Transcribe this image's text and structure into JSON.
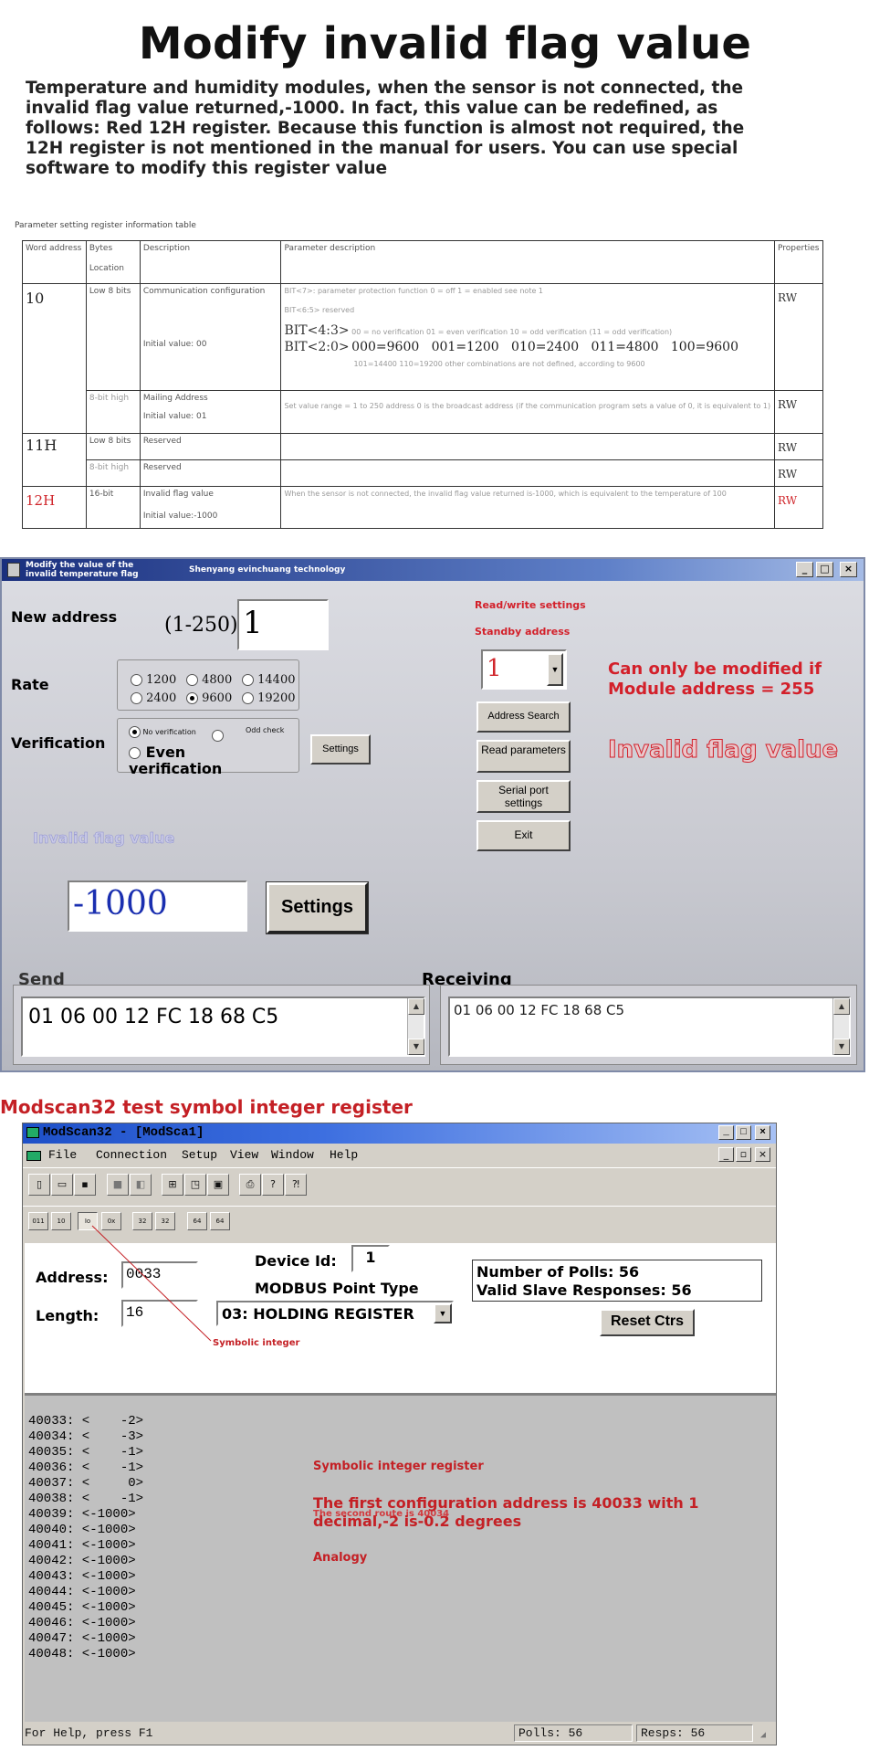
{
  "heading": "Modify invalid flag value",
  "intro": "Temperature and humidity modules, when the sensor is not connected, the invalid flag value returned,-1000. In fact, this value can be redefined, as follows: Red 12H register. Because this function is almost not required, the 12H register is not mentioned in the manual for users. You can use special software to modify this register value",
  "table": {
    "caption": "Parameter setting register information table",
    "headers": {
      "word": "Word address",
      "bytes": "Bytes",
      "location": "Location",
      "description": "Description",
      "param": "Parameter description",
      "props": "Properties"
    },
    "row10": {
      "addr": "10",
      "low": "Low 8 bits",
      "desc": "Communication configuration",
      "init": "Initial value: 00",
      "bit7": "BIT<7>: parameter protection function 0 = off 1 = enabled see note 1",
      "bit65": "BIT<6:5> reserved",
      "bit43": "BIT<4:3>",
      "bit43_desc": "00 = no verification 01 = even verification 10 = odd verification (11 = odd verification)",
      "bit20": "BIT<2:0>",
      "baud": "000=9600   001=1200   010=2400   011=4800   100=9600",
      "baud_note": "101=14400 110=19200 other combinations are not defined, according to 9600",
      "prop": "RW"
    },
    "row10b": {
      "high": "8-bit high",
      "desc": "Mailing Address",
      "init": "Initial value: 01",
      "param": "Set value range = 1 to 250 address 0 is the broadcast address (if the communication program sets a value of 0, it is equivalent to 1)",
      "prop": "RW"
    },
    "row11": {
      "addr": "11H",
      "low": "Low 8 bits",
      "desc": "Reserved",
      "prop": "RW"
    },
    "row11b": {
      "high": "8-bit high",
      "desc": "Reserved",
      "prop": "RW"
    },
    "row12": {
      "addr": "12H",
      "bytes": "16-bit",
      "desc": "Invalid flag value",
      "init": "Initial value:-1000",
      "param": "When the sensor is not connected, the invalid flag value returned is-1000, which is equivalent to the temperature of 100",
      "prop": "RW"
    }
  },
  "dialog": {
    "title": "Modify the value of the invalid temperature flag",
    "company": "Shenyang evinchuang technology",
    "new_address_label": "New address",
    "range": "(1-250)",
    "new_address_value": "1",
    "rate_label": "Rate",
    "rates": [
      "1200",
      "4800",
      "14400",
      "2400",
      "9600",
      "19200"
    ],
    "rate_selected": "9600",
    "verification_label": "Verification",
    "no_verification": "No verification",
    "odd_check": "Odd check",
    "even_verification": "Even verification",
    "settings_btn": "Settings",
    "rw_settings": "Read/write settings",
    "standby_address": "Standby address",
    "standby_value": "1",
    "note": "Can only be modified if Module address = 255",
    "invalid_flag_outline": "Invalid flag value",
    "address_search": "Address Search",
    "read_params": "Read parameters",
    "serial_settings": "Serial port settings",
    "exit": "Exit",
    "invalid_flag_label": "Invalid flag value",
    "invalid_value": "-1000",
    "settings_big": "Settings",
    "send_label": "Send",
    "send_value": "01 06 00 12 FC 18 68 C5",
    "receive_label": "Receiving",
    "receive_value": "01 06 00 12 FC 18 68 C5"
  },
  "modscan_heading": "Modscan32 test symbol integer register",
  "modscan": {
    "title": "ModScan32 - [ModSca1]",
    "menu": [
      "File",
      "Connection",
      "Setup",
      "View",
      "Window",
      "Help"
    ],
    "address_label": "Address:",
    "address_value": "0033",
    "length_label": "Length:",
    "length_value": "16",
    "device_id_label": "Device Id:",
    "device_id_value": "1",
    "point_type_label": "MODBUS Point Type",
    "point_type_value": "03: HOLDING REGISTER",
    "polls": "Number of Polls: 56",
    "valid": "Valid Slave Responses: 56",
    "reset": "Reset Ctrs",
    "symbolic_annot": "Symbolic integer",
    "registers": [
      "40033: <    -2>",
      "40034: <    -3>",
      "40035: <    -1>",
      "40036: <    -1>",
      "40037: <     0>",
      "40038: <    -1>",
      "40039: <-1000>",
      "40040: <-1000>",
      "40041: <-1000>",
      "40042: <-1000>",
      "40043: <-1000>",
      "40044: <-1000>",
      "40045: <-1000>",
      "40046: <-1000>",
      "40047: <-1000>",
      "40048: <-1000>"
    ],
    "annot_register": "Symbolic integer register",
    "annot_first": "The first configuration address is 40033 with 1 decimal,-2 is-0.2 degrees",
    "annot_second": "The second route is 40034",
    "annot_analogy": "Analogy",
    "status_help": "For Help, press F1",
    "status_polls": "Polls: 56",
    "status_resps": "Resps: 56"
  }
}
